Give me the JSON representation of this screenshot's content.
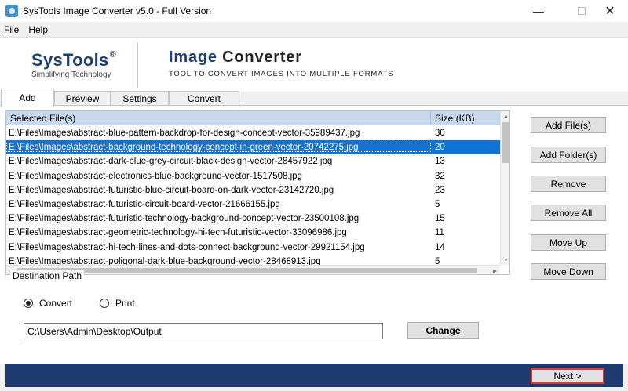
{
  "window": {
    "title": "SysTools Image Converter v5.0 - Full Version",
    "minimize_glyph": "—",
    "close_glyph": "✕"
  },
  "menu": {
    "items": [
      "File",
      "Help"
    ]
  },
  "banner": {
    "brand": "SysTools",
    "brand_mark": "®",
    "tagline": "Simplifying Technology",
    "product_word1": "Image",
    "product_word2": "Converter",
    "subtitle": "TOOL TO CONVERT IMAGES INTO MULTIPLE FORMATS"
  },
  "tabs": [
    {
      "label": "Add",
      "active": true
    },
    {
      "label": "Preview",
      "active": false
    },
    {
      "label": "Settings",
      "active": false
    },
    {
      "label": "Convert",
      "active": false
    }
  ],
  "file_list": {
    "columns": {
      "file": "Selected File(s)",
      "size": "Size (KB)"
    },
    "rows": [
      {
        "file": "E:\\Files\\Images\\abstract-blue-pattern-backdrop-for-design-concept-vector-35989437.jpg",
        "size": "30",
        "selected": false
      },
      {
        "file": "E:\\Files\\Images\\abstract-background-technology-concept-in-green-vector-20742275.jpg",
        "size": "20",
        "selected": true
      },
      {
        "file": "E:\\Files\\Images\\abstract-dark-blue-grey-circuit-black-design-vector-28457922.jpg",
        "size": "13",
        "selected": false
      },
      {
        "file": "E:\\Files\\Images\\abstract-electronics-blue-background-vector-1517508.jpg",
        "size": "32",
        "selected": false
      },
      {
        "file": "E:\\Files\\Images\\abstract-futuristic-blue-circuit-board-on-dark-vector-23142720.jpg",
        "size": "23",
        "selected": false
      },
      {
        "file": "E:\\Files\\Images\\abstract-futuristic-circuit-board-vector-21666155.jpg",
        "size": "5",
        "selected": false
      },
      {
        "file": "E:\\Files\\Images\\abstract-futuristic-technology-background-concept-vector-23500108.jpg",
        "size": "15",
        "selected": false
      },
      {
        "file": "E:\\Files\\Images\\abstract-geometric-technology-hi-tech-futuristic-vector-33096986.jpg",
        "size": "11",
        "selected": false
      },
      {
        "file": "E:\\Files\\Images\\abstract-hi-tech-lines-and-dots-connect-background-vector-29921154.jpg",
        "size": "14",
        "selected": false
      },
      {
        "file": "E:\\Files\\Images\\abstract-poligonal-dark-blue-background-vector-28468913.jpg",
        "size": "5",
        "selected": false
      }
    ]
  },
  "side_buttons": {
    "add_files": "Add File(s)",
    "add_folder": "Add Folder(s)",
    "remove": "Remove",
    "remove_all": "Remove All",
    "move_up": "Move Up",
    "move_down": "Move Down"
  },
  "destination": {
    "legend": "Destination Path",
    "option_convert": "Convert",
    "option_print": "Print",
    "selected_option": "Convert",
    "path": "C:\\Users\\Admin\\Desktop\\Output",
    "change_label": "Change"
  },
  "footer": {
    "next_label": "Next  >"
  },
  "colors": {
    "brand_blue": "#1d3f6e",
    "selection_blue": "#0f74d5",
    "header_blue": "#c7d8ee",
    "footer_blue": "#1e3a6e",
    "next_border_red": "#d63b3b"
  }
}
